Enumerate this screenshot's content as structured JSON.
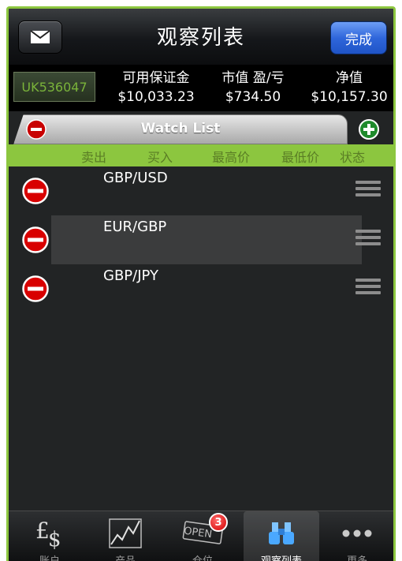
{
  "nav": {
    "title": "观察列表",
    "done_label": "完成"
  },
  "account": {
    "id": "UK536047",
    "metrics": [
      {
        "label": "可用保证金",
        "value": "$10,033.23"
      },
      {
        "label": "市值 盈/亏",
        "value": "$734.50"
      },
      {
        "label": "净值",
        "value": "$10,157.30"
      }
    ]
  },
  "watchlist": {
    "title": "Watch List",
    "columns": [
      "卖出",
      "买入",
      "最高价",
      "最低价",
      "状态"
    ],
    "rows": [
      {
        "symbol": "GBP/USD"
      },
      {
        "symbol": "EUR/GBP"
      },
      {
        "symbol": "GBP/JPY"
      }
    ]
  },
  "tabs": [
    {
      "label": "账户"
    },
    {
      "label": "产品"
    },
    {
      "label": "仓位",
      "badge": "3",
      "icon_text": "OPEN"
    },
    {
      "label": "观察列表"
    },
    {
      "label": "更多"
    }
  ],
  "colors": {
    "accent": "#8cc63f",
    "done": "#2f66db",
    "delete": "#d80000"
  }
}
